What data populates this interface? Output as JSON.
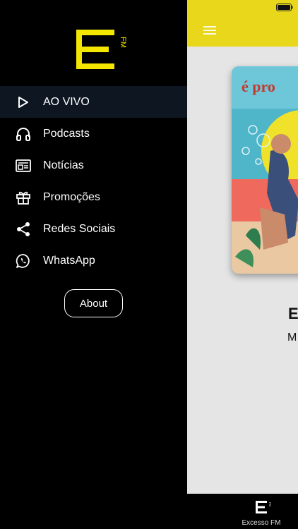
{
  "sidebar": {
    "logo_text": "E FM",
    "items": [
      {
        "label": "AO VIVO",
        "icon": "play-icon",
        "active": true
      },
      {
        "label": "Podcasts",
        "icon": "headphones-icon",
        "active": false
      },
      {
        "label": "Notícias",
        "icon": "newspaper-icon",
        "active": false
      },
      {
        "label": "Promoções",
        "icon": "gift-icon",
        "active": false
      },
      {
        "label": "Redes Sociais",
        "icon": "share-icon",
        "active": false
      },
      {
        "label": "WhatsApp",
        "icon": "whatsapp-icon",
        "active": false
      }
    ],
    "about_label": "About"
  },
  "now_playing": {
    "title_partial": "E",
    "subtitle_partial": "M",
    "artwork_text": "é pro"
  },
  "bottom_bar": {
    "label": "Excesso FM"
  },
  "colors": {
    "accent": "#e8d71a",
    "sidebar_bg": "#000000",
    "active_item_bg": "#0e1621",
    "main_bg": "#e5e5e5"
  }
}
